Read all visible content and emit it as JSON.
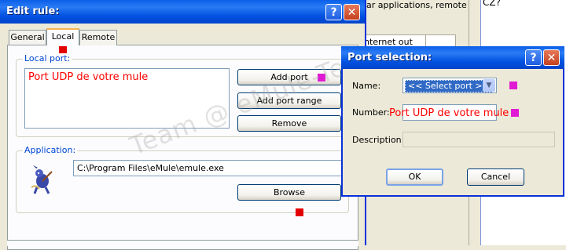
{
  "background": {
    "text_line": "ar applications, remote",
    "table_cell": "nternet out",
    "right_text": "CZ?"
  },
  "edit_rule": {
    "title": "Edit rule:",
    "help_glyph": "?",
    "close_glyph": "✕",
    "tabs": [
      {
        "label": "General"
      },
      {
        "label": "Local"
      },
      {
        "label": "Remote"
      }
    ],
    "local_port": {
      "group_label": "Local port:",
      "list_item": "Port UDP de votre mule",
      "add_port": "Add port",
      "add_port_range": "Add port range",
      "remove": "Remove"
    },
    "application": {
      "group_label": "Application:",
      "path": "C:\\Program Files\\eMule\\emule.exe",
      "browse": "Browse"
    },
    "watermark": "Team @ eMule-Tech"
  },
  "port_selection": {
    "title": "Port selection:",
    "help_glyph": "?",
    "close_glyph": "✕",
    "name_label": "Name:",
    "name_value": "<< Select port >>",
    "number_label": "Number:",
    "number_value": "Port UDP de votre mule",
    "description_label": "Description:",
    "description_value": "",
    "ok": "OK",
    "cancel": "Cancel"
  },
  "colors": {
    "titlebar": "#0a5fe8",
    "annotation_red": "#e30000",
    "annotation_magenta": "#e01bd3",
    "handwritten_text": "#ff0000"
  }
}
